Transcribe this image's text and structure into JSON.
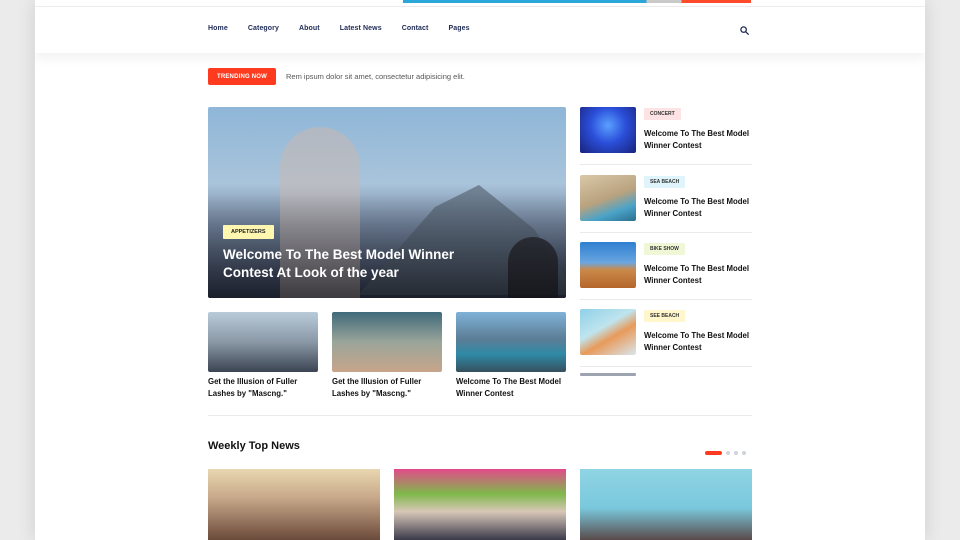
{
  "nav": {
    "items": [
      "Home",
      "Category",
      "About",
      "Latest News",
      "Contact",
      "Pages"
    ]
  },
  "trending": {
    "label": "TRENDING NOW",
    "text": "Rem ipsum dolor sit amet, consectetur adipisicing elit."
  },
  "hero": {
    "badge": "APPETIZERS",
    "title": "Welcome To The Best Model Winner Contest At Look of the year"
  },
  "small_cards": [
    {
      "caption": "Get the Illusion of Fuller Lashes by \"Mascng.\""
    },
    {
      "caption": "Get the Illusion of Fuller Lashes by \"Mascng.\""
    },
    {
      "caption": "Welcome To The Best Model Winner Contest"
    }
  ],
  "side_items": [
    {
      "tag": "CONCERT",
      "title": "Welcome To The Best Model Winner Contest",
      "tag_color": "#fde3e3"
    },
    {
      "tag": "SEA BEACH",
      "title": "Welcome To The Best Model Winner Contest",
      "tag_color": "#e0f5fb"
    },
    {
      "tag": "BIKE SHOW",
      "title": "Welcome To The Best Model Winner Contest",
      "tag_color": "#f0f7d6"
    },
    {
      "tag": "SEE BEACH",
      "title": "Welcome To The Best Model Winner Contest",
      "tag_color": "#fff6cc"
    }
  ],
  "weekly": {
    "title": "Weekly Top News"
  },
  "colors": {
    "accent": "#ff3b1f",
    "nav_text": "#1e2a55"
  }
}
